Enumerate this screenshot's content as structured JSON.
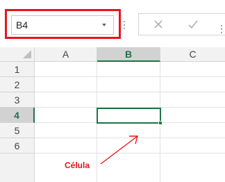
{
  "name_box": {
    "value": "B4"
  },
  "formula_bar": {
    "cancel_icon": "close-icon",
    "enter_icon": "checkmark-icon"
  },
  "columns": [
    "A",
    "B",
    "C"
  ],
  "rows": [
    "1",
    "2",
    "3",
    "4",
    "5",
    "6"
  ],
  "selected": {
    "column": "B",
    "row": "4"
  },
  "annotation": {
    "label": "Célula"
  },
  "colors": {
    "highlight_red": "#e8141c",
    "excel_green": "#217346",
    "header_bg": "#f2f2f2",
    "gridline": "#e1e1e1"
  }
}
